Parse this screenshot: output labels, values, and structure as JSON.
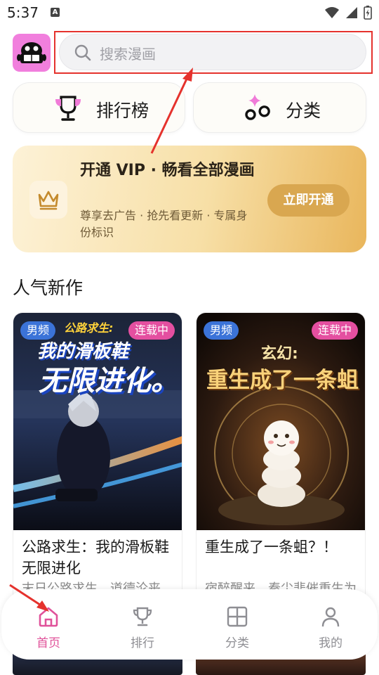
{
  "status_bar": {
    "time": "5:37",
    "indicator": "A"
  },
  "search": {
    "placeholder": "搜索漫画"
  },
  "quick_actions": [
    {
      "label": "排行榜",
      "icon": "trophy-icon"
    },
    {
      "label": "分类",
      "icon": "category-shapes-icon"
    }
  ],
  "vip_banner": {
    "title": "开通 VIP · 畅看全部漫画",
    "subtitle": "尊享去广告 · 抢先看更新 · 专属身份标识",
    "button_label": "立即开通",
    "icon": "crown-icon"
  },
  "section": {
    "title": "人气新作"
  },
  "comics": [
    {
      "title": "公路求生：我的滑板鞋无限进化",
      "description": "末日公路求生，道德沦丧...",
      "badge_channel": "男频",
      "badge_status": "连载中",
      "cover_text_top": "公路求生:",
      "cover_text_mid": "我的滑板鞋",
      "cover_text_big": "无限进化。"
    },
    {
      "title": "重生成了一条蛆？！",
      "description": "宿醉醒来，秦尘悲催重生为一条渺小的蛆虫",
      "badge_channel": "男频",
      "badge_status": "连载中",
      "cover_text_top": "玄幻:",
      "cover_text_big": "重生成了一条蛆"
    }
  ],
  "bottom_nav": [
    {
      "label": "首页",
      "icon": "home-icon",
      "active": true
    },
    {
      "label": "排行",
      "icon": "trophy-icon",
      "active": false
    },
    {
      "label": "分类",
      "icon": "grid-icon",
      "active": false
    },
    {
      "label": "我的",
      "icon": "person-icon",
      "active": false
    }
  ],
  "colors": {
    "accent": "#e0529a",
    "vip_gold": "#d9a750",
    "badge_blue": "#3b73d8",
    "badge_pink": "#e44fa0",
    "annotation_red": "#e5322d"
  }
}
